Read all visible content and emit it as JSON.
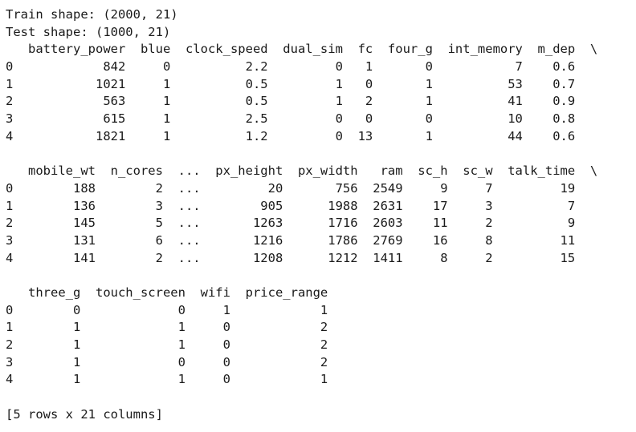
{
  "output": {
    "train_shape": "Train shape: (2000, 21)",
    "test_shape": "Test shape: (1000, 21)",
    "blocks": [
      {
        "header": "   battery_power  blue  clock_speed  dual_sim  fc  four_g  int_memory  m_dep  \\",
        "rows": [
          "0            842     0          2.2         0   1       0           7    0.6",
          "1           1021     1          0.5         1   0       1          53    0.7",
          "2            563     1          0.5         1   2       1          41    0.9",
          "3            615     1          2.5         0   0       0          10    0.8",
          "4           1821     1          1.2         0  13       1          44    0.6"
        ]
      },
      {
        "header": "   mobile_wt  n_cores  ...  px_height  px_width   ram  sc_h  sc_w  talk_time  \\",
        "rows": [
          "0        188        2  ...         20       756  2549     9     7         19",
          "1        136        3  ...        905      1988  2631    17     3          7",
          "2        145        5  ...       1263      1716  2603    11     2          9",
          "3        131        6  ...       1216      1786  2769    16     8         11",
          "4        141        2  ...       1208      1212  1411     8     2         15"
        ]
      },
      {
        "header": "   three_g  touch_screen  wifi  price_range",
        "rows": [
          "0        0             0     1            1",
          "1        1             1     0            2",
          "2        1             1     0            2",
          "3        1             0     0            2",
          "4        1             1     0            1"
        ]
      }
    ],
    "footer": "[5 rows x 21 columns]"
  }
}
